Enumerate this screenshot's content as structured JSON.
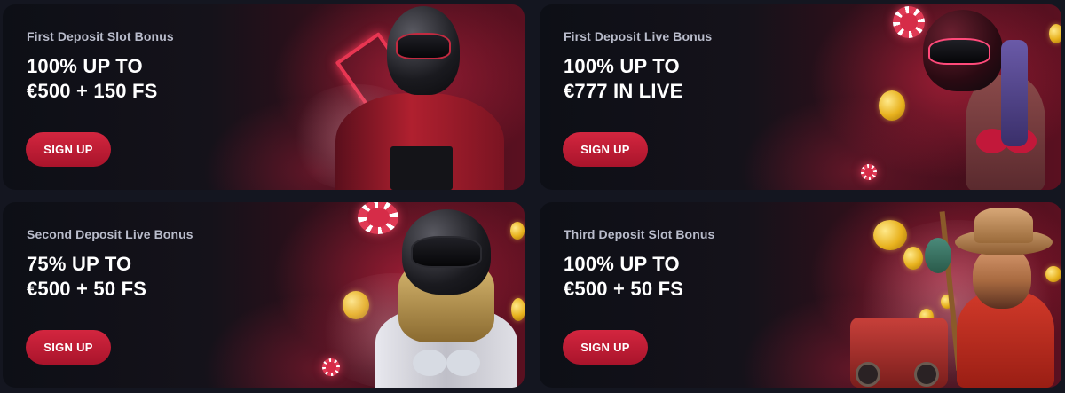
{
  "cards": [
    {
      "subtitle": "First Deposit Slot Bonus",
      "offer_line1": "100% UP TO",
      "offer_line2": "€500 + 150 FS",
      "cta": "SIGN UP"
    },
    {
      "subtitle": "First Deposit Live Bonus",
      "offer_line1": "100% UP TO",
      "offer_line2": "€777 IN LIVE",
      "cta": "SIGN UP"
    },
    {
      "subtitle": "Second Deposit Live Bonus",
      "offer_line1": "75% UP TO",
      "offer_line2": "€500 + 50 FS",
      "cta": "SIGN UP"
    },
    {
      "subtitle": "Third Deposit Slot Bonus",
      "offer_line1": "100% UP TO",
      "offer_line2": "€500 + 50 FS",
      "cta": "SIGN UP"
    }
  ],
  "colors": {
    "background": "#141620",
    "cta_red": "#c01d35",
    "accent_red": "#d62c48",
    "subtitle_gray": "#b9bccb",
    "coin_gold": "#e8b21e"
  }
}
